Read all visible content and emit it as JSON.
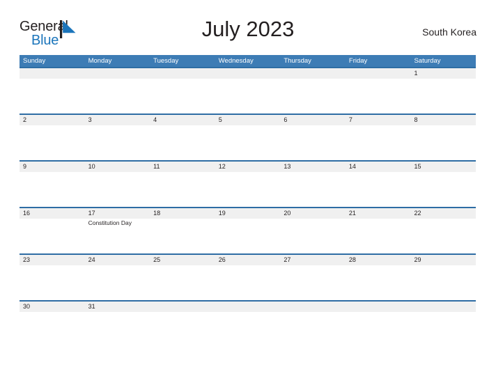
{
  "brand": {
    "word_one": "General",
    "word_two": "Blue",
    "mark_icon": "general-blue-flag-icon",
    "accent_color": "#1b75bb"
  },
  "header": {
    "title": "July 2023",
    "region": "South Korea"
  },
  "colors": {
    "header_blue": "#3d7cb5",
    "divider_blue": "#2e6da4",
    "number_band_gray": "#f0f0f0",
    "text": "#231f20"
  },
  "calendar": {
    "month": "July",
    "year": "2023",
    "weekday_headers": [
      "Sunday",
      "Monday",
      "Tuesday",
      "Wednesday",
      "Thursday",
      "Friday",
      "Saturday"
    ],
    "weeks": [
      {
        "days": [
          {
            "number": "",
            "event": ""
          },
          {
            "number": "",
            "event": ""
          },
          {
            "number": "",
            "event": ""
          },
          {
            "number": "",
            "event": ""
          },
          {
            "number": "",
            "event": ""
          },
          {
            "number": "",
            "event": ""
          },
          {
            "number": "1",
            "event": ""
          }
        ]
      },
      {
        "days": [
          {
            "number": "2",
            "event": ""
          },
          {
            "number": "3",
            "event": ""
          },
          {
            "number": "4",
            "event": ""
          },
          {
            "number": "5",
            "event": ""
          },
          {
            "number": "6",
            "event": ""
          },
          {
            "number": "7",
            "event": ""
          },
          {
            "number": "8",
            "event": ""
          }
        ]
      },
      {
        "days": [
          {
            "number": "9",
            "event": ""
          },
          {
            "number": "10",
            "event": ""
          },
          {
            "number": "11",
            "event": ""
          },
          {
            "number": "12",
            "event": ""
          },
          {
            "number": "13",
            "event": ""
          },
          {
            "number": "14",
            "event": ""
          },
          {
            "number": "15",
            "event": ""
          }
        ]
      },
      {
        "days": [
          {
            "number": "16",
            "event": ""
          },
          {
            "number": "17",
            "event": "Constitution Day"
          },
          {
            "number": "18",
            "event": ""
          },
          {
            "number": "19",
            "event": ""
          },
          {
            "number": "20",
            "event": ""
          },
          {
            "number": "21",
            "event": ""
          },
          {
            "number": "22",
            "event": ""
          }
        ]
      },
      {
        "days": [
          {
            "number": "23",
            "event": ""
          },
          {
            "number": "24",
            "event": ""
          },
          {
            "number": "25",
            "event": ""
          },
          {
            "number": "26",
            "event": ""
          },
          {
            "number": "27",
            "event": ""
          },
          {
            "number": "28",
            "event": ""
          },
          {
            "number": "29",
            "event": ""
          }
        ]
      },
      {
        "days": [
          {
            "number": "30",
            "event": ""
          },
          {
            "number": "31",
            "event": ""
          },
          {
            "number": "",
            "event": ""
          },
          {
            "number": "",
            "event": ""
          },
          {
            "number": "",
            "event": ""
          },
          {
            "number": "",
            "event": ""
          },
          {
            "number": "",
            "event": ""
          }
        ]
      }
    ]
  }
}
